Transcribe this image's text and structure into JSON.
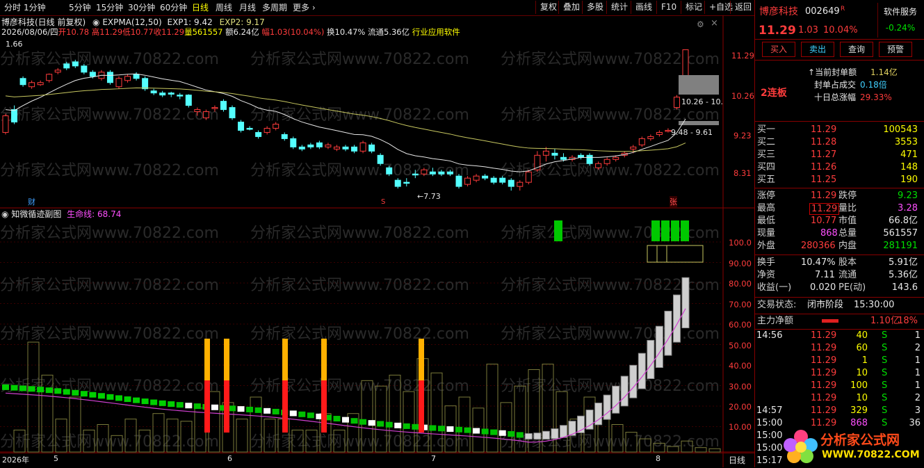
{
  "toolbar": {
    "periods": [
      "分时",
      "1分钟",
      "5分钟",
      "15分钟",
      "30分钟",
      "60分钟",
      "日线",
      "周线",
      "月线",
      "多周期",
      "更多"
    ],
    "active_period": "日线",
    "buttons": [
      "复权",
      "叠加",
      "多股",
      "统计",
      "画线",
      "F10",
      "标记",
      "+自选",
      "返回"
    ]
  },
  "main_chart": {
    "title": "博彦科技(日线 前复权)",
    "indicator": "EXPMA(12,50)",
    "exp1": "EXP1: 9.42",
    "exp2": "EXP2: 9.17",
    "info_date": "2026/08/06/四",
    "info_open": "开10.78",
    "info_high": "高11.29",
    "info_low": "低10.77",
    "info_close": "收11.29",
    "info_vol": "量561557",
    "info_amt": "额6.24亿",
    "info_range": "幅1.03(10.04%)",
    "info_turnover": "换10.47%",
    "info_float": "流通5.36亿",
    "info_industry": "行业应用软件",
    "marker_high": "1.66",
    "marker_low": "7.73",
    "marker_cai": "财",
    "marker_s": "S",
    "marker_zhang": "张",
    "box_label_1": "10.26 - 10.",
    "box_label_2": "9.48 - 9.61",
    "y_ticks": [
      "11.29",
      "10.26",
      "9.23",
      "8.31"
    ]
  },
  "sub_chart": {
    "title": "知微循迹副图",
    "line_label": "生命线: 68.74",
    "y_ticks": [
      "100.0",
      "90.00",
      "80.00",
      "70.00",
      "60.00",
      "50.00",
      "40.00",
      "30.00",
      "20.00",
      "10.00"
    ]
  },
  "x_axis": {
    "labels": [
      "2026年",
      "5",
      "6",
      "7",
      "8"
    ],
    "period_label": "日线"
  },
  "watermark": "分析家公式网www.70822.com",
  "panel": {
    "stock_name": "博彦科技",
    "stock_code": "002649",
    "r_tag": "R",
    "price": "11.29",
    "change": "1.03",
    "change_pct": "10.04%",
    "software_label": "软件服务",
    "software_pct": "-0.24%",
    "btn_buy": "买入",
    "btn_sell": "卖出",
    "btn_query": "查询",
    "btn_alert": "预警",
    "seal_label": "当前封单额",
    "seal_value": "1.14亿",
    "seal_ratio_label": "封单占成交",
    "seal_ratio_value": "0.18倍",
    "ten_day_label": "十日总涨幅",
    "ten_day_value": "29.33%",
    "streak": "2连板",
    "bids": [
      {
        "label": "买一",
        "price": "11.29",
        "vol": "100543"
      },
      {
        "label": "买二",
        "price": "11.28",
        "vol": "3553"
      },
      {
        "label": "买三",
        "price": "11.27",
        "vol": "471"
      },
      {
        "label": "买四",
        "price": "11.26",
        "vol": "148"
      },
      {
        "label": "买五",
        "price": "11.25",
        "vol": "190"
      }
    ],
    "limit_up_label": "涨停",
    "limit_up": "11.29",
    "limit_down_label": "跌停",
    "limit_down": "9.23",
    "high_label": "最高",
    "high": "11.29",
    "vol_ratio_label": "量比",
    "vol_ratio": "3.28",
    "low_label": "最低",
    "low": "10.77",
    "mkt_cap_label": "市值",
    "mkt_cap": "66.8亿",
    "cur_vol_label": "现量",
    "cur_vol": "868",
    "total_vol_label": "总量",
    "total_vol": "561557",
    "outer_label": "外盘",
    "outer": "280366",
    "inner_label": "内盘",
    "inner": "281191",
    "turnover_label": "换手",
    "turnover": "10.47%",
    "shares_label": "股本",
    "shares": "5.91亿",
    "nav_label": "净资",
    "nav": "7.11",
    "float_label": "流通",
    "float": "5.36亿",
    "eps_label": "收益(一)",
    "eps": "0.020",
    "pe_label": "PE(动)",
    "pe": "143.6",
    "status_label": "交易状态:",
    "status_value": "闭市阶段",
    "status_time": "15:30:00",
    "net_flow_label": "主力净额",
    "net_flow_value": "1.10亿",
    "net_flow_pct": "18%",
    "ticks": [
      {
        "time": "14:56",
        "price": "11.29",
        "vol": "40",
        "bs": "S",
        "n": "1"
      },
      {
        "time": "",
        "price": "11.29",
        "vol": "60",
        "bs": "S",
        "n": "2"
      },
      {
        "time": "",
        "price": "11.29",
        "vol": "1",
        "bs": "S",
        "n": "1"
      },
      {
        "time": "",
        "price": "11.29",
        "vol": "10",
        "bs": "S",
        "n": "1"
      },
      {
        "time": "",
        "price": "11.29",
        "vol": "100",
        "bs": "S",
        "n": "1"
      },
      {
        "time": "",
        "price": "11.29",
        "vol": "10",
        "bs": "S",
        "n": "2"
      },
      {
        "time": "14:57",
        "price": "11.29",
        "vol": "329",
        "bs": "S",
        "n": "3"
      },
      {
        "time": "15:00",
        "price": "11.29",
        "vol": "868",
        "bs": "S",
        "n": "36"
      },
      {
        "time": "15:00",
        "price": "",
        "vol": "",
        "bs": "",
        "n": ""
      },
      {
        "time": "15:00",
        "price": "",
        "vol": "",
        "bs": "",
        "n": ""
      },
      {
        "time": "15:17",
        "price": "",
        "vol": "",
        "bs": "",
        "n": ""
      }
    ],
    "logo_text": "分析家公式网",
    "logo_url": "WWW.70822.COM"
  },
  "candles": [
    [
      9.3,
      9.7,
      9.25,
      9.75,
      "up"
    ],
    [
      9.85,
      9.55,
      9.5,
      9.95,
      "dn"
    ],
    [
      10.6,
      10.45,
      10.4,
      10.65,
      "dn"
    ],
    [
      10.4,
      10.5,
      10.35,
      10.55,
      "up"
    ],
    [
      10.45,
      10.5,
      10.42,
      10.55,
      "up"
    ],
    [
      10.55,
      10.7,
      10.5,
      10.72,
      "up"
    ],
    [
      10.75,
      10.8,
      10.7,
      10.85,
      "up"
    ],
    [
      10.95,
      10.85,
      10.8,
      11.0,
      "dn"
    ],
    [
      11.0,
      10.9,
      10.85,
      11.05,
      "dn"
    ],
    [
      10.9,
      10.75,
      10.7,
      10.95,
      "dn"
    ],
    [
      10.75,
      10.65,
      10.6,
      10.8,
      "dn"
    ],
    [
      10.6,
      10.75,
      10.55,
      10.8,
      "up"
    ],
    [
      10.75,
      10.5,
      10.45,
      10.8,
      "dn"
    ],
    [
      10.4,
      10.6,
      10.35,
      10.65,
      "up"
    ],
    [
      10.55,
      10.65,
      10.5,
      10.7,
      "up"
    ],
    [
      10.7,
      10.6,
      10.55,
      10.75,
      "dn"
    ],
    [
      10.6,
      10.35,
      10.3,
      10.65,
      "dn"
    ],
    [
      10.3,
      10.25,
      10.2,
      10.35,
      "dn"
    ],
    [
      10.25,
      10.2,
      10.15,
      10.3,
      "dn"
    ],
    [
      10.25,
      10.22,
      10.15,
      10.28,
      "dn"
    ],
    [
      10.2,
      10.2,
      10.1,
      10.25,
      "dn"
    ],
    [
      10.2,
      9.95,
      9.9,
      10.22,
      "dn"
    ],
    [
      9.8,
      9.85,
      9.7,
      9.9,
      "up"
    ],
    [
      9.65,
      9.8,
      9.6,
      9.85,
      "up"
    ],
    [
      9.9,
      9.9,
      9.8,
      9.95,
      "up"
    ],
    [
      10.05,
      9.85,
      9.8,
      10.1,
      "dn"
    ],
    [
      9.9,
      9.65,
      9.6,
      9.95,
      "dn"
    ],
    [
      9.55,
      9.35,
      9.3,
      9.6,
      "dn"
    ],
    [
      9.4,
      9.4,
      9.35,
      9.45,
      "dn"
    ],
    [
      9.3,
      9.2,
      9.15,
      9.35,
      "dn"
    ],
    [
      9.3,
      9.4,
      9.25,
      9.45,
      "up"
    ],
    [
      9.4,
      9.5,
      9.35,
      9.55,
      "up"
    ],
    [
      9.25,
      9.15,
      9.1,
      9.3,
      "dn"
    ],
    [
      9.15,
      8.95,
      8.9,
      9.2,
      "dn"
    ],
    [
      8.9,
      8.95,
      8.85,
      9.0,
      "dn"
    ],
    [
      8.95,
      9.0,
      8.9,
      9.05,
      "dn"
    ],
    [
      9.05,
      8.95,
      8.9,
      9.1,
      "dn"
    ],
    [
      8.95,
      9.0,
      8.9,
      9.05,
      "up"
    ],
    [
      8.9,
      8.95,
      8.85,
      9.0,
      "up"
    ],
    [
      8.95,
      8.9,
      8.85,
      9.0,
      "dn"
    ],
    [
      8.95,
      8.85,
      8.8,
      9.0,
      "dn"
    ],
    [
      8.85,
      9.05,
      8.8,
      9.1,
      "up"
    ],
    [
      9.0,
      8.85,
      8.8,
      9.05,
      "dn"
    ],
    [
      8.75,
      8.55,
      8.5,
      8.8,
      "dn"
    ],
    [
      8.45,
      8.3,
      8.25,
      8.5,
      "dn"
    ],
    [
      8.15,
      8.0,
      7.95,
      8.2,
      "dn"
    ],
    [
      8.1,
      8.1,
      8.0,
      8.2,
      "dn"
    ],
    [
      8.3,
      8.3,
      8.2,
      8.4,
      "dn"
    ],
    [
      8.3,
      8.4,
      8.25,
      8.45,
      "up"
    ],
    [
      8.35,
      8.3,
      8.25,
      8.45,
      "dn"
    ],
    [
      8.3,
      8.35,
      8.25,
      8.4,
      "dn"
    ],
    [
      8.35,
      8.3,
      8.25,
      8.4,
      "dn"
    ],
    [
      8.25,
      8.0,
      7.95,
      8.3,
      "dn"
    ],
    [
      8.05,
      8.2,
      8.0,
      8.25,
      "up"
    ],
    [
      8.15,
      8.25,
      8.1,
      8.3,
      "up"
    ],
    [
      8.25,
      8.2,
      8.15,
      8.3,
      "dn"
    ],
    [
      8.2,
      8.1,
      8.05,
      8.25,
      "dn"
    ],
    [
      8.2,
      8.1,
      8.05,
      8.25,
      "dn"
    ],
    [
      8.15,
      8.0,
      7.9,
      8.2,
      "dn"
    ],
    [
      8.0,
      8.1,
      7.9,
      8.15,
      "up"
    ],
    [
      8.1,
      8.35,
      8.05,
      8.4,
      "up"
    ],
    [
      8.4,
      8.75,
      8.35,
      8.85,
      "up"
    ],
    [
      8.75,
      8.85,
      8.6,
      8.95,
      "up"
    ],
    [
      8.8,
      8.75,
      8.65,
      8.9,
      "dn"
    ],
    [
      8.7,
      8.65,
      8.6,
      8.8,
      "dn"
    ],
    [
      8.65,
      8.7,
      8.6,
      8.75,
      "up"
    ],
    [
      8.7,
      8.75,
      8.65,
      8.8,
      "dn"
    ],
    [
      8.75,
      8.55,
      8.5,
      8.8,
      "dn"
    ],
    [
      8.45,
      8.55,
      8.4,
      8.6,
      "up"
    ],
    [
      8.55,
      8.65,
      8.5,
      8.7,
      "up"
    ],
    [
      8.65,
      8.7,
      8.6,
      8.75,
      "up"
    ],
    [
      8.75,
      8.8,
      8.7,
      8.85,
      "up"
    ],
    [
      8.9,
      8.95,
      8.8,
      9.0,
      "up"
    ],
    [
      9.0,
      9.15,
      8.95,
      9.2,
      "up"
    ],
    [
      9.15,
      9.2,
      9.1,
      9.25,
      "up"
    ],
    [
      9.25,
      9.3,
      9.2,
      9.35,
      "up"
    ],
    [
      9.35,
      9.35,
      9.3,
      9.4,
      "up"
    ],
    [
      9.9,
      10.15,
      9.85,
      10.2,
      "up"
    ],
    [
      10.65,
      11.29,
      10.6,
      11.29,
      "up"
    ]
  ],
  "lights": [
    [
      2.5,
      "up"
    ],
    [
      1.5,
      "dn"
    ],
    [
      1.5,
      "dn"
    ],
    [
      1.4,
      "dn"
    ],
    [
      0.9,
      "dn"
    ],
    [
      0.7,
      "dn"
    ],
    [
      0.7,
      "up"
    ],
    [
      0.8,
      "up"
    ],
    [
      0.6,
      "up"
    ],
    [
      0.6,
      "up"
    ],
    [
      0.5,
      "dn"
    ],
    [
      0.4,
      "dn"
    ],
    [
      0.3,
      "dn"
    ],
    [
      0.2,
      "dn"
    ],
    [
      0.2,
      "up"
    ],
    [
      0.3,
      "up"
    ],
    [
      0.3,
      "dn"
    ],
    [
      0.2,
      "dn"
    ],
    [
      0.2,
      "dn"
    ],
    [
      0.3,
      "dn"
    ],
    [
      0.2,
      "up"
    ],
    [
      0.2,
      "dn"
    ],
    [
      0.3,
      "dn"
    ],
    [
      0.2,
      "dn"
    ]
  ]
}
